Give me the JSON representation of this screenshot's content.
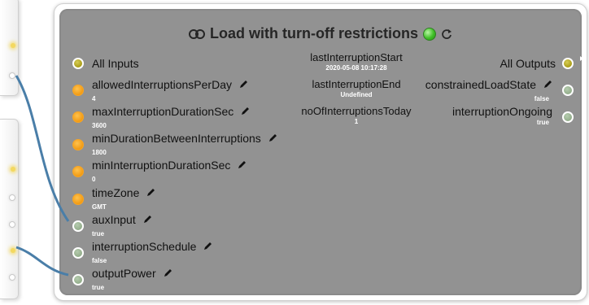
{
  "node": {
    "title": "Load with turn-off restrictions",
    "status_color": "#3fbf27"
  },
  "inputs": {
    "all_label": "All Inputs",
    "items": [
      {
        "label": "allowedInterruptionsPerDay",
        "value": "4",
        "color": "orange"
      },
      {
        "label": "maxInterruptionDurationSec",
        "value": "3600",
        "color": "orange"
      },
      {
        "label": "minDurationBetweenInterruptions",
        "value": "1800",
        "color": "orange"
      },
      {
        "label": "minInterruptionDurationSec",
        "value": "0",
        "color": "orange"
      },
      {
        "label": "timeZone",
        "value": "GMT",
        "color": "orange"
      },
      {
        "label": "auxInput",
        "value": "true",
        "color": "gray"
      },
      {
        "label": "interruptionSchedule",
        "value": "false",
        "color": "gray"
      },
      {
        "label": "outputPower",
        "value": "true",
        "color": "gray"
      }
    ]
  },
  "attributes": [
    {
      "label": "lastInterruptionStart",
      "value": "2020-05-08 10:17:28"
    },
    {
      "label": "lastInterruptionEnd",
      "value": "Undefined"
    },
    {
      "label": "noOfInterruptionsToday",
      "value": "1"
    }
  ],
  "outputs": {
    "all_label": "All Outputs",
    "items": [
      {
        "label": "constrainedLoadState",
        "value": "false",
        "editable": true
      },
      {
        "label": "interruptionOngoing",
        "value": "true",
        "editable": false
      }
    ]
  },
  "colors": {
    "node_body": "#929292",
    "port_orange": "#f19b15",
    "port_olive": "#a99c17",
    "port_gray": "#93ad8b",
    "wire": "#4a7ea8"
  },
  "icons": [
    "toggle-icon",
    "status-dot-icon",
    "refresh-icon",
    "pencil-icon"
  ]
}
